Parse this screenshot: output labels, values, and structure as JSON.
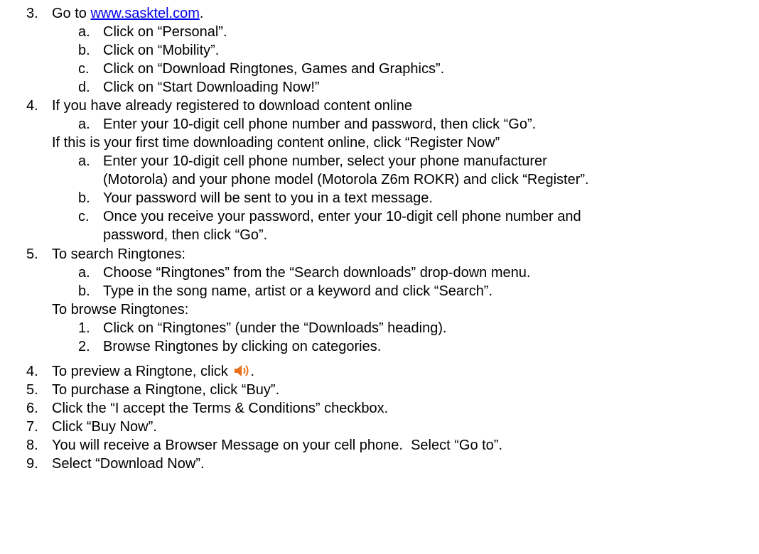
{
  "step3": {
    "number": "3.",
    "prefix": "Go to ",
    "link": "www.sasktel.com",
    "suffix": ".",
    "subs": [
      {
        "marker": "a.",
        "text": "Click on “Personal”."
      },
      {
        "marker": "b.",
        "text": "Click on “Mobility”."
      },
      {
        "marker": "c.",
        "text": "Click on “Download Ringtones, Games and Graphics”."
      },
      {
        "marker": "d.",
        "text": "Click on “Start Downloading Now!”"
      }
    ]
  },
  "step4": {
    "number": "4.",
    "text": "If you have already registered to download content online",
    "sub_a": {
      "marker": "a.",
      "text": "Enter your 10-digit cell phone number and password, then click “Go”."
    },
    "first_time": "If this is your first time downloading content online, click “Register Now”",
    "first_time_subs": [
      {
        "marker": "a.",
        "line1": "Enter your 10-digit cell phone number, select your phone manufacturer",
        "line2": "(Motorola) and your phone model (Motorola Z6m ROKR) and click “Register”."
      },
      {
        "marker": "b.",
        "line1": "Your password will be sent to you in a text message.",
        "line2": ""
      },
      {
        "marker": "c.",
        "line1": "Once you receive your password, enter your 10-digit cell phone number and",
        "line2": "password, then click “Go”."
      }
    ]
  },
  "step5": {
    "number": "5.",
    "text": "To search Ringtones:",
    "search_subs": [
      {
        "marker": "a.",
        "text": "Choose “Ringtones” from the “Search downloads” drop-down menu."
      },
      {
        "marker": "b.",
        "text": "Type in the song name, artist or a keyword and click “Search”."
      }
    ],
    "browse": "To browse Ringtones:",
    "browse_subs": [
      {
        "marker": "1.",
        "text": "Click on “Ringtones” (under the “Downloads” heading)."
      },
      {
        "marker": "2.",
        "text": "Browse Ringtones by clicking on categories."
      }
    ]
  },
  "later_steps": [
    {
      "number": "4.",
      "text": "To preview a Ringtone, click",
      "suffix": ".",
      "icon": "speaker-icon"
    },
    {
      "number": "5.",
      "text": "To purchase a Ringtone, click “Buy”."
    },
    {
      "number": "6.",
      "text": "Click the “I accept the Terms & Conditions” checkbox."
    },
    {
      "number": "7.",
      "text": "Click “Buy Now”."
    },
    {
      "number": "8.",
      "text": "You will receive a Browser Message on your cell phone.  Select “Go to”."
    },
    {
      "number": "9.",
      "text": "Select “Download Now”."
    }
  ],
  "colors": {
    "link": "#0000ee",
    "speaker": "#e8731a"
  }
}
